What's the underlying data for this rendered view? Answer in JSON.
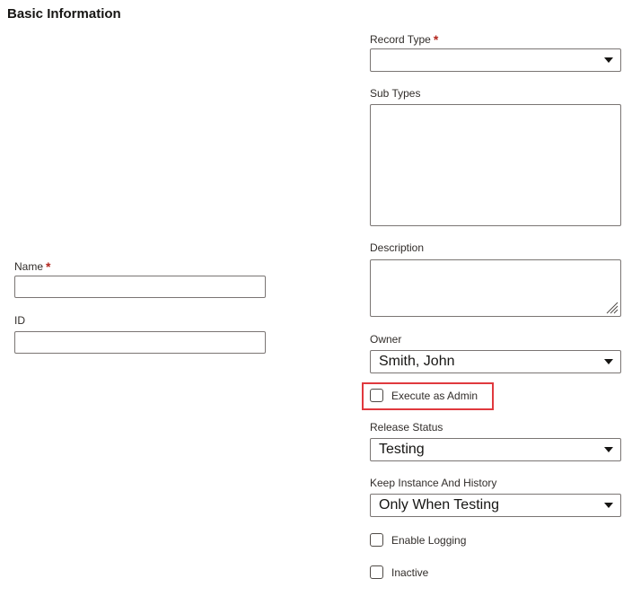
{
  "section": {
    "title": "Basic Information"
  },
  "required_marker": "*",
  "fields": {
    "record_type": {
      "label": "Record Type",
      "value": ""
    },
    "sub_types": {
      "label": "Sub Types"
    },
    "name": {
      "label": "Name",
      "value": ""
    },
    "description": {
      "label": "Description",
      "value": ""
    },
    "id": {
      "label": "ID",
      "value": ""
    },
    "owner": {
      "label": "Owner",
      "value": "Smith, John"
    },
    "execute_as_admin": {
      "label": "Execute as Admin",
      "checked": false
    },
    "release_status": {
      "label": "Release Status",
      "value": "Testing"
    },
    "keep_instance": {
      "label": "Keep Instance And History",
      "value": "Only When Testing"
    },
    "enable_logging": {
      "label": "Enable Logging",
      "checked": false
    },
    "inactive": {
      "label": "Inactive",
      "checked": false
    }
  },
  "colors": {
    "required": "#b3261e",
    "highlight": "#e0393e",
    "border": "#7a7573"
  }
}
